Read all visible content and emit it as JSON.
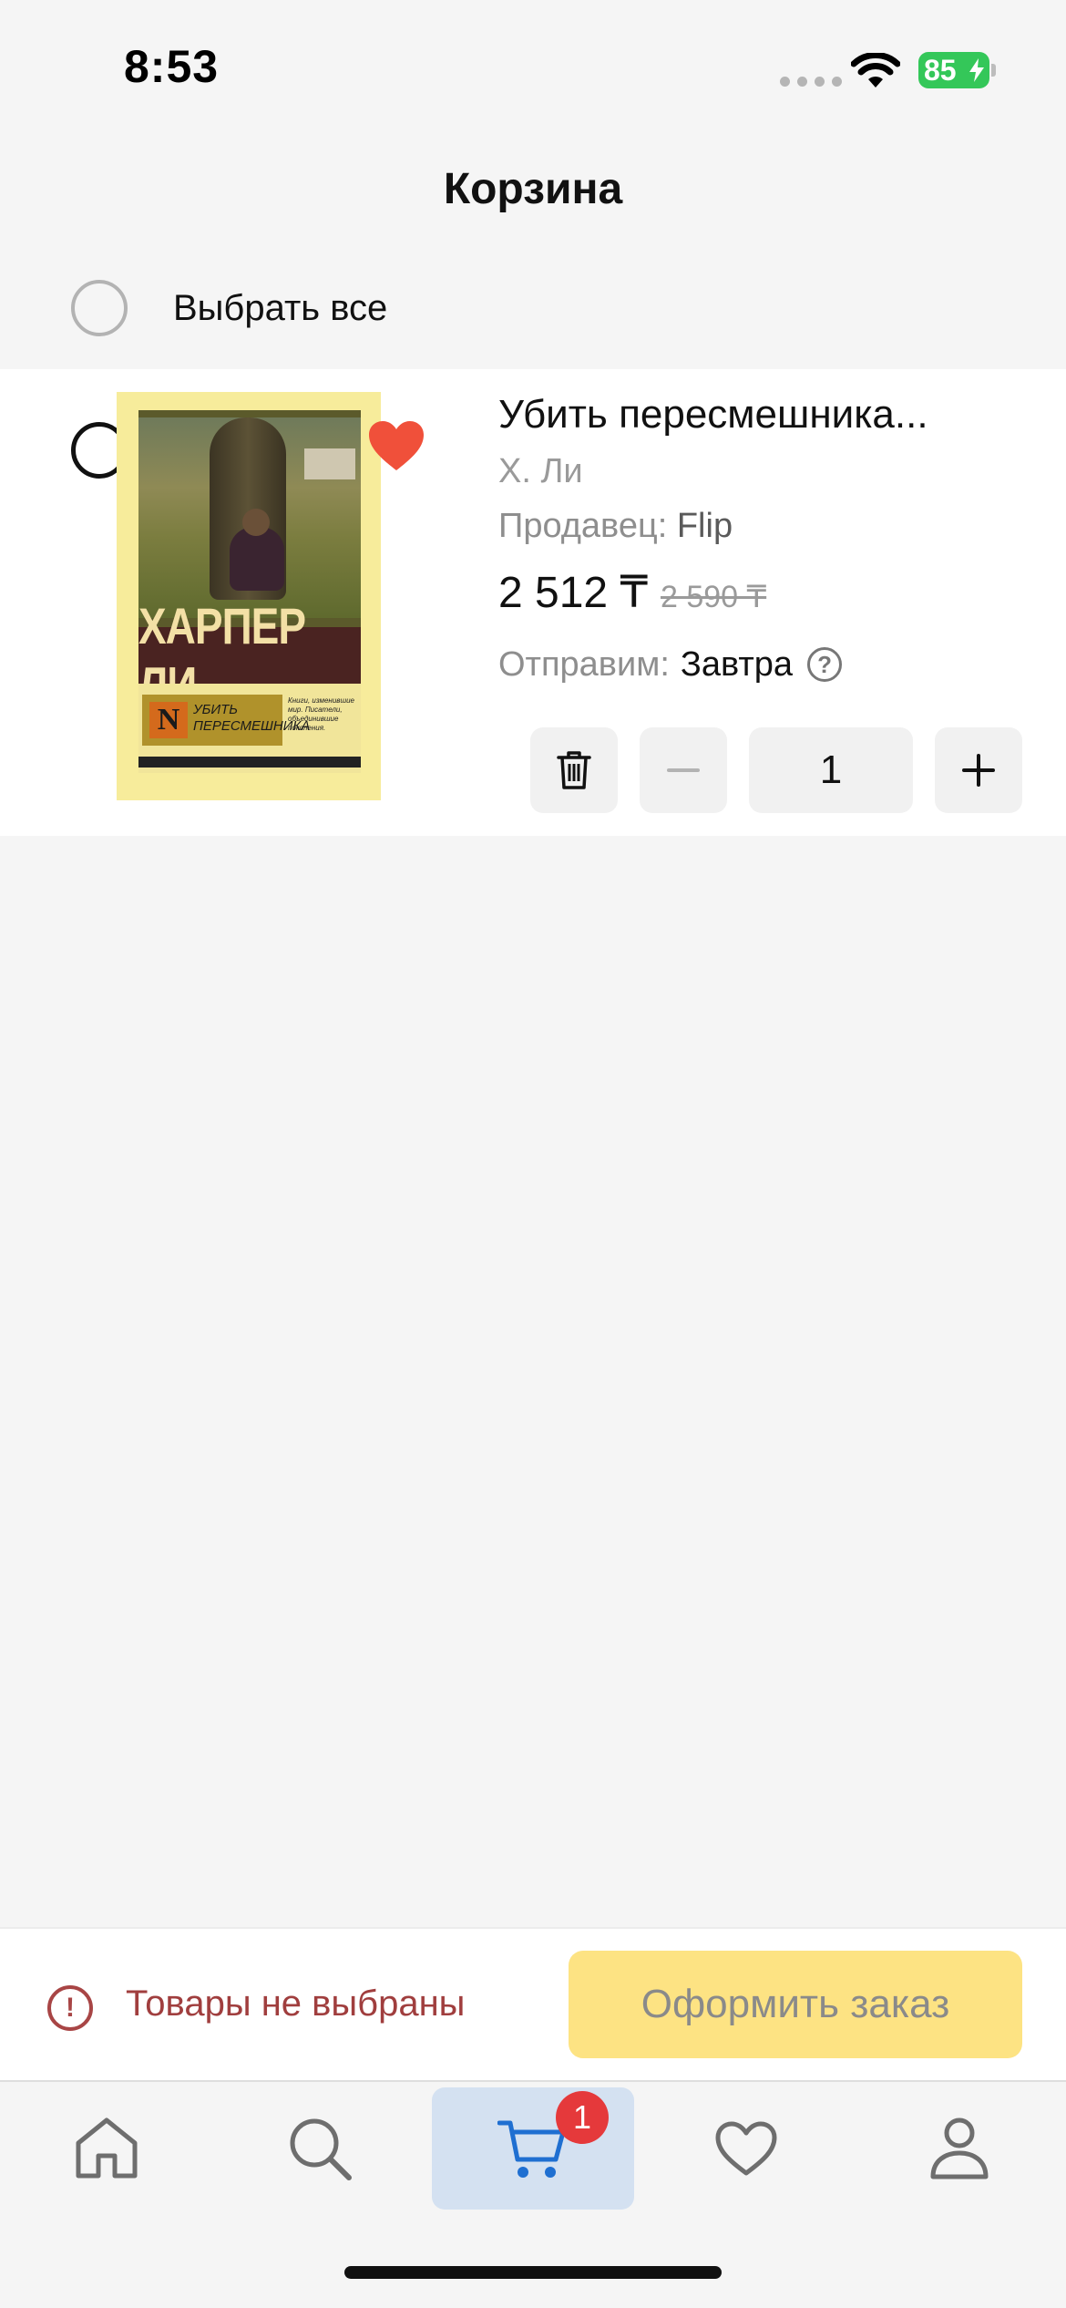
{
  "status_bar": {
    "time": "8:53",
    "battery": "85"
  },
  "header": {
    "title": "Корзина"
  },
  "select_all": {
    "label": "Выбрать все"
  },
  "item": {
    "title": "Убить пересмешника...",
    "author": "Х. Ли",
    "seller_label": "Продавец:",
    "seller_name": "Flip",
    "price": "2 512 ₸",
    "old_price": "2 590 ₸",
    "ship_label": "Отправим:",
    "ship_value": "Завтра",
    "quantity": "1",
    "cover": {
      "author": "ХАРПЕР ЛИ",
      "logo": "N",
      "title_line1": "УБИТЬ",
      "title_line2": "ПЕРЕСМЕШНИКА",
      "blurb": "Книги, изменившие мир. Писатели, объединившие поколения."
    }
  },
  "order_bar": {
    "warning": "Товары не выбраны",
    "checkout_label": "Оформить заказ"
  },
  "tab_bar": {
    "cart_badge": "1"
  },
  "colors": {
    "accent_yellow": "#fde383",
    "warning_red": "#a03e3e",
    "heart": "#f0503a",
    "badge_red": "#e5393b",
    "cart_tab_bg": "#d4e1f1"
  }
}
